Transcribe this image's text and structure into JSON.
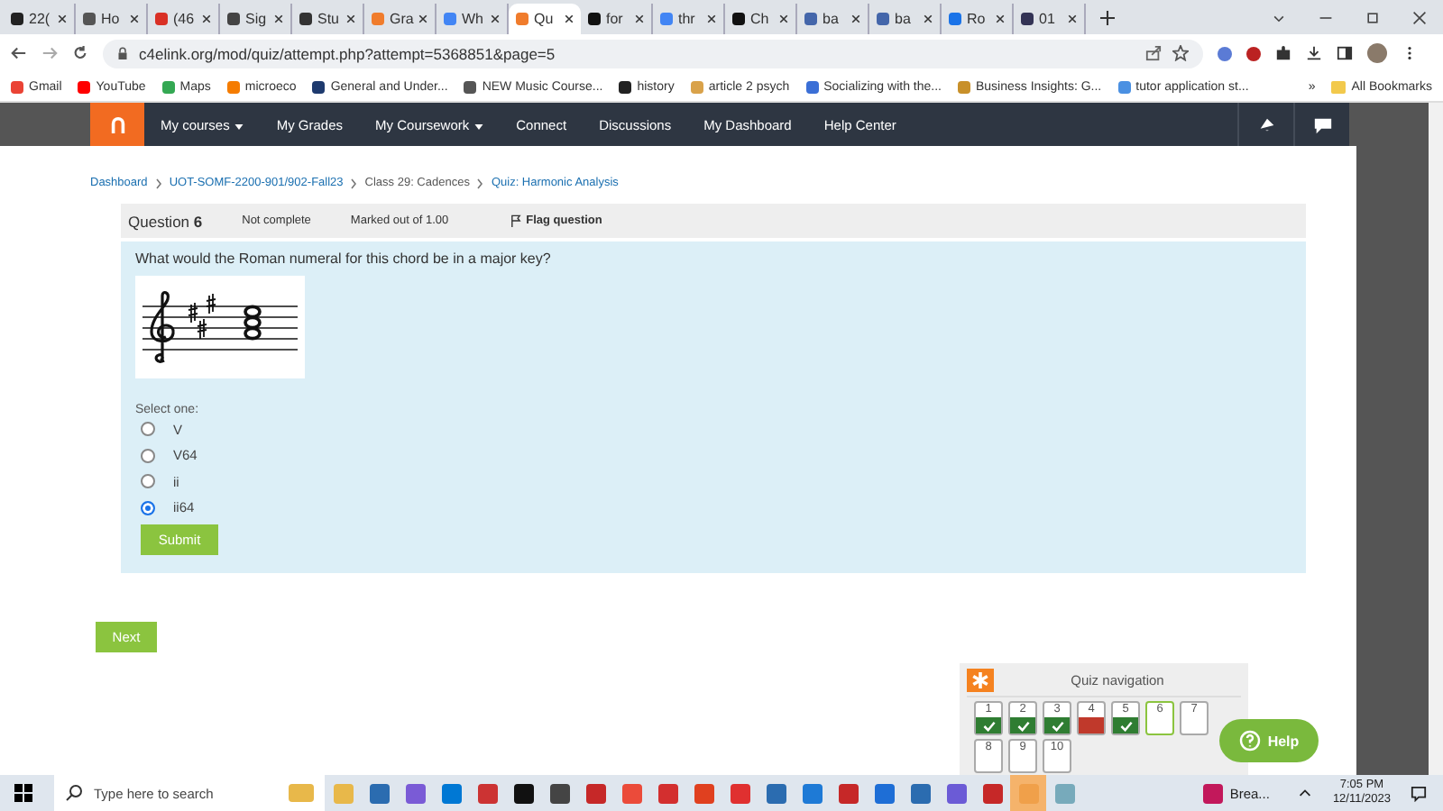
{
  "browser": {
    "tabs": [
      {
        "label": "22(",
        "selected": false
      },
      {
        "label": "Ho",
        "selected": false
      },
      {
        "label": "(46",
        "selected": false
      },
      {
        "label": "Sig",
        "selected": false
      },
      {
        "label": "Stu",
        "selected": false
      },
      {
        "label": "Gra",
        "selected": false
      },
      {
        "label": "Wh",
        "selected": false
      },
      {
        "label": "Qu",
        "selected": true
      },
      {
        "label": "for",
        "selected": false
      },
      {
        "label": "thr",
        "selected": false
      },
      {
        "label": "Ch",
        "selected": false
      },
      {
        "label": "ba",
        "selected": false
      },
      {
        "label": "ba",
        "selected": false
      },
      {
        "label": "Ro",
        "selected": false
      },
      {
        "label": "01",
        "selected": false
      }
    ],
    "url": "c4elink.org/mod/quiz/attempt.php?attempt=5368851&page=5",
    "bookmarks": [
      "Gmail",
      "YouTube",
      "Maps",
      "microeco",
      "General and Under...",
      "NEW Music Course...",
      "history",
      "article 2 psych",
      "Socializing with the...",
      "Business Insights: G...",
      "tutor application st..."
    ],
    "bookmarks_more": "»",
    "all_bookmarks": "All Bookmarks"
  },
  "nav": {
    "items": [
      {
        "label": "My courses",
        "dropdown": true
      },
      {
        "label": "My Grades",
        "dropdown": false
      },
      {
        "label": "My Coursework",
        "dropdown": true
      },
      {
        "label": "Connect",
        "dropdown": false
      },
      {
        "label": "Discussions",
        "dropdown": false
      },
      {
        "label": "My Dashboard",
        "dropdown": false
      },
      {
        "label": "Help Center",
        "dropdown": false
      }
    ]
  },
  "breadcrumb": [
    "Dashboard",
    "UOT-SOMF-2200-901/902-Fall23",
    "Class 29: Cadences",
    "Quiz: Harmonic Analysis"
  ],
  "question": {
    "label": "Question",
    "number": "6",
    "status": "Not complete",
    "marks": "Marked out of 1.00",
    "flag": "Flag question",
    "prompt": "What would the Roman numeral for this chord be in a major key?",
    "select_label": "Select one:",
    "options": [
      {
        "label": "V",
        "selected": false
      },
      {
        "label": "V64",
        "selected": false
      },
      {
        "label": "ii",
        "selected": false
      },
      {
        "label": "ii64",
        "selected": true
      }
    ],
    "submit": "Submit"
  },
  "next": "Next",
  "quiz_nav": {
    "title": "Quiz navigation",
    "items": [
      {
        "number": "1",
        "kind": "correct"
      },
      {
        "number": "2",
        "kind": "correct"
      },
      {
        "number": "3",
        "kind": "correct"
      },
      {
        "number": "4",
        "kind": "incorrect"
      },
      {
        "number": "5",
        "kind": "correct"
      },
      {
        "number": "6",
        "kind": "current"
      },
      {
        "number": "7",
        "kind": "unanswered"
      },
      {
        "number": "8",
        "kind": "unanswered"
      },
      {
        "number": "9",
        "kind": "unanswered"
      },
      {
        "number": "10",
        "kind": "unanswered"
      }
    ]
  },
  "help": "Help",
  "taskbar": {
    "search_placeholder": "Type here to search",
    "weather": "Brea...",
    "time": "7:05 PM",
    "date": "12/11/2023"
  }
}
